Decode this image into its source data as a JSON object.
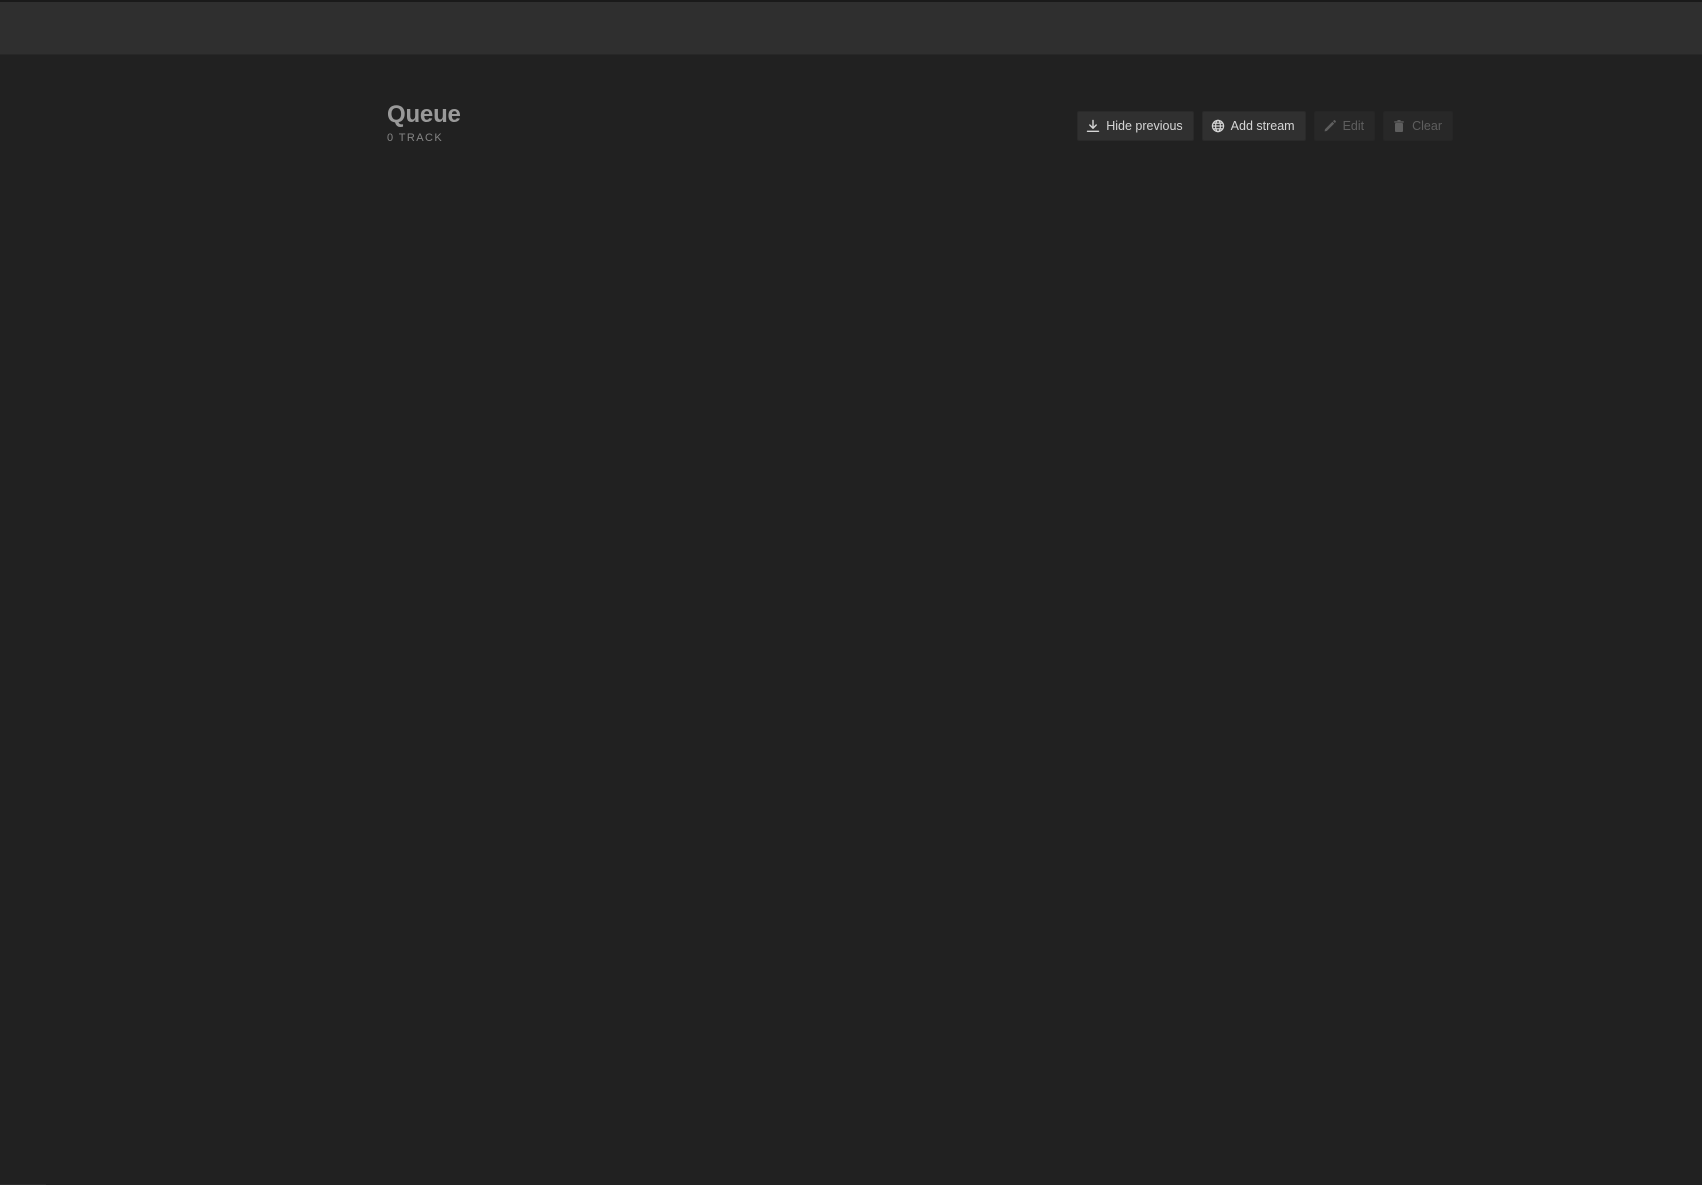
{
  "queue": {
    "title": "Queue",
    "track_count": "0 TRACK"
  },
  "toolbar": {
    "hide_previous_label": "Hide previous",
    "add_stream_label": "Add stream",
    "edit_label": "Edit",
    "clear_label": "Clear",
    "icons": {
      "hide_previous": "download-icon",
      "add_stream": "globe-icon",
      "edit": "pencil-icon",
      "clear": "trash-icon"
    }
  },
  "colors": {
    "background": "#212121",
    "top_bar": "#2f2f2f",
    "button_bg": "#303030",
    "button_text": "#d6d6d6",
    "disabled_text": "#5e5e5e"
  }
}
